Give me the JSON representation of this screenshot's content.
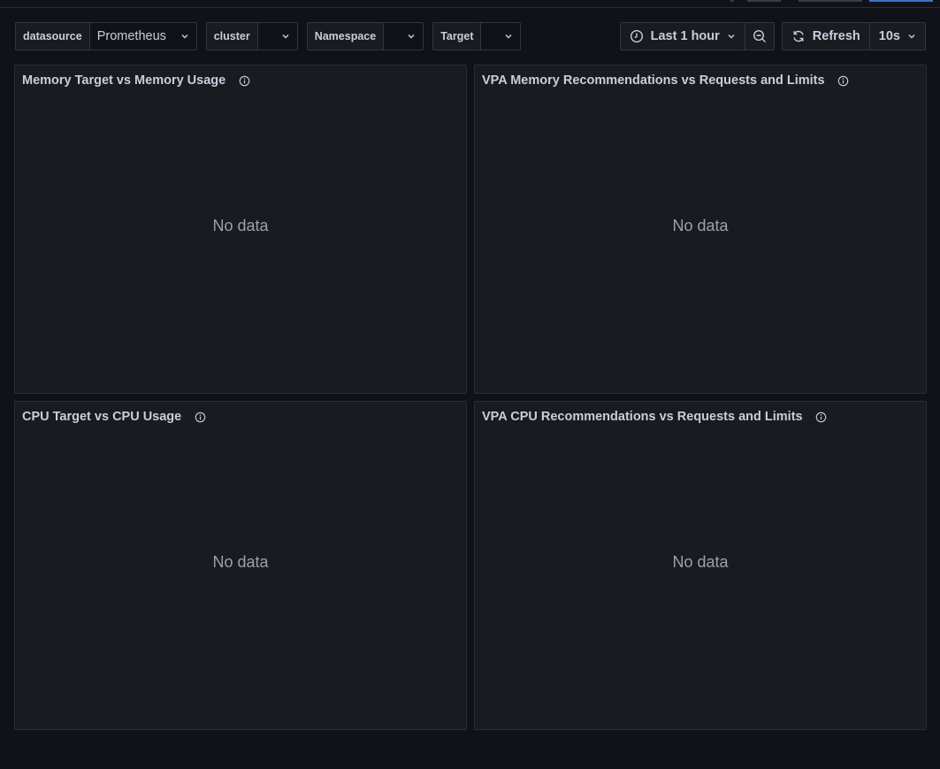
{
  "variables": [
    {
      "label": "datasource",
      "value": "Prometheus"
    },
    {
      "label": "cluster",
      "value": ""
    },
    {
      "label": "Namespace",
      "value": ""
    },
    {
      "label": "Target",
      "value": ""
    }
  ],
  "time_picker": {
    "label": "Last 1 hour"
  },
  "refresh": {
    "label": "Refresh",
    "interval": "10s"
  },
  "panels": [
    {
      "title": "Memory Target vs Memory Usage",
      "empty_text": "No data"
    },
    {
      "title": "VPA Memory Recommendations vs Requests and Limits",
      "empty_text": "No data"
    },
    {
      "title": "CPU Target vs CPU Usage",
      "empty_text": "No data"
    },
    {
      "title": "VPA CPU Recommendations vs Requests and Limits",
      "empty_text": "No data"
    }
  ],
  "icons": {
    "clock": "clock-icon",
    "zoom_out": "zoom-out-icon",
    "refresh": "refresh-icon",
    "chevron": "chevron-down-icon",
    "info": "info-icon"
  },
  "colors": {
    "background": "#111217",
    "panel_bg": "#181b1f",
    "border": "#33353c",
    "text": "#ccccdc",
    "muted": "#9fa1a8"
  }
}
